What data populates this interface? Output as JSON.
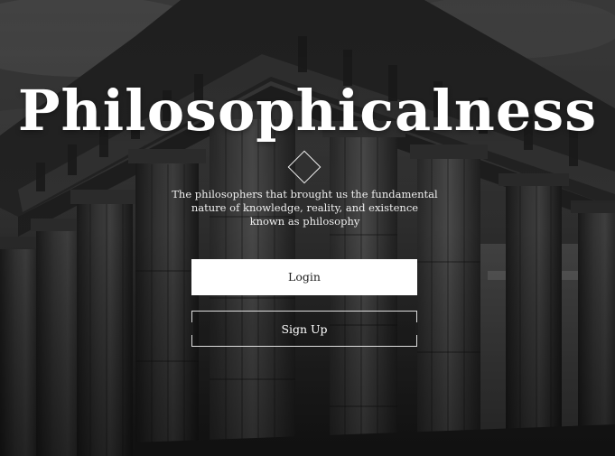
{
  "hero": {
    "title": "Philosophicalness",
    "tagline_lines": [
      "The philosophers that brought us the fundamental",
      "nature of knowledge, reality, and existence",
      "known as philosophy"
    ]
  },
  "actions": {
    "login_label": "Login",
    "signup_label": "Sign Up"
  },
  "theme": {
    "background_tone": "#2a2a2a",
    "text": "#ffffff",
    "button_fill": "#ffffff"
  },
  "icons": {
    "divider": "diamond-outline-icon"
  }
}
